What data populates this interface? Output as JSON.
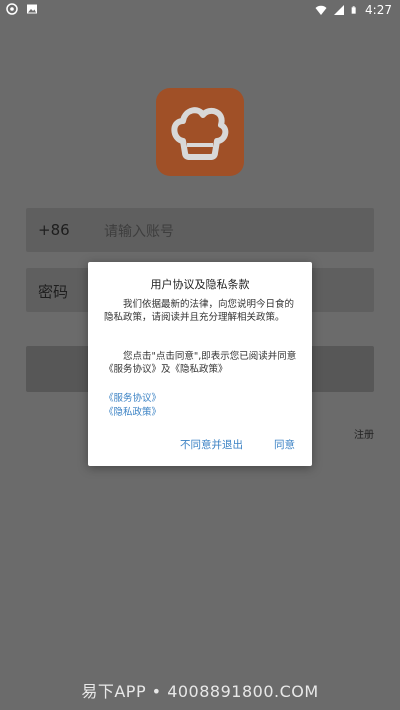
{
  "status_bar": {
    "time": "4:27",
    "icons": [
      "app-icon",
      "image-icon",
      "wifi-icon",
      "signal-icon",
      "battery-icon"
    ]
  },
  "login": {
    "country_code": "+86",
    "phone_placeholder": "请输入账号",
    "password_label": "密码",
    "register_label": "注册"
  },
  "dialog": {
    "title": "用户协议及隐私条款",
    "paragraph1": "我们依据最新的法律，向您说明今日食的隐私政策，请阅读并且充分理解相关政策。",
    "paragraph2": "您点击\"点击同意\",即表示您已阅读并同意《服务协议》及《隐私政策》",
    "link_service": "《服务协议》",
    "link_privacy": "《隐私政策》",
    "disagree_label": "不同意并退出",
    "agree_label": "同意"
  },
  "watermark": "易下APP • 4008891800.COM",
  "colors": {
    "overlay_background": "#6b6b6b",
    "logo_background": "#a05027",
    "link_blue": "#3b82c4"
  }
}
